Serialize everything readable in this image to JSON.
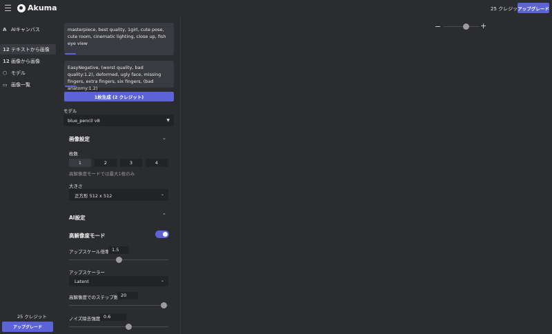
{
  "header": {
    "logo_text": "Akuma",
    "credits": "25 クレジット",
    "upgrade": "アップグレード"
  },
  "sidebar": {
    "items": [
      {
        "icon": "A",
        "label": "AIキャンバス"
      },
      {
        "icon": "12",
        "label": "テキストから画像"
      },
      {
        "icon": "12",
        "label": "画像から画像"
      },
      {
        "icon": "⬡",
        "label": "モデル"
      },
      {
        "icon": "▭",
        "label": "画像一覧"
      }
    ],
    "credits": "25 クレジット",
    "upgrade": "アップグレード"
  },
  "panel": {
    "prompt": "masterpiece, best quality, 1girl, cute pose, cute room, cinematic lighting, close up, fish eye view",
    "negative_prompt": "EasyNegative, (worst quality, bad quality:1.2), deformed, ugly face, missing fingers, extra fingers, six fingers, (bad anatomy:1.2)",
    "generate_label": "1枚生成 (2 クレジット)",
    "model_label": "モデル",
    "model_value": "blue_pencil v8",
    "image_settings": {
      "title": "画像設定",
      "count_label": "枚数",
      "counts": [
        "1",
        "2",
        "3",
        "4"
      ],
      "selected_count": "1",
      "count_hint": "高解像度モードでは最大1枚のみ",
      "size_label": "大きさ",
      "size_value": "正方形 512 x 512"
    },
    "ai_settings": {
      "title": "AI設定",
      "hires_label": "高解像度モード",
      "hires_on": true,
      "upscale_label": "アップスケール倍率",
      "upscale_value": "1.5",
      "upscale_fraction": 0.5,
      "upscaler_label": "アップスケーラー",
      "upscaler_value": "Latent",
      "steps_label": "高解像度でのステップ数",
      "steps_value": "20",
      "steps_fraction": 0.95,
      "denoise_label": "ノイズ除去強度",
      "denoise_value": "0.6",
      "denoise_fraction": 0.6
    }
  },
  "canvas": {
    "zoom_fraction": 0.62
  },
  "colors": {
    "accent": "#5b63d6",
    "background": "#2b2c2f",
    "field": "#222326"
  }
}
